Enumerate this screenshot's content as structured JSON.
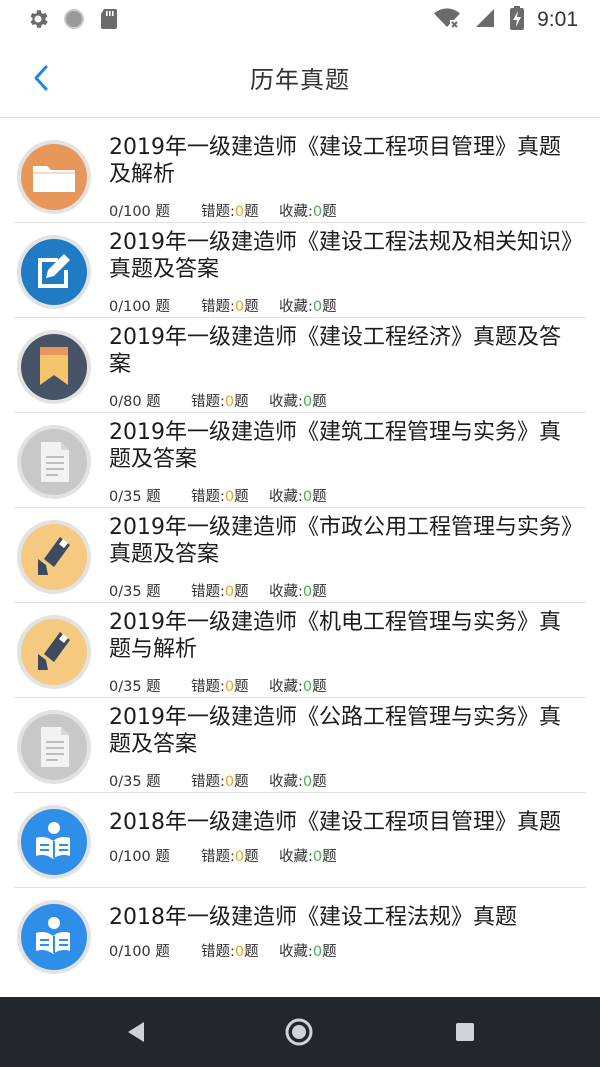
{
  "status_bar": {
    "time": "9:01",
    "left_icons": [
      "gear-icon",
      "circle-icon",
      "sd-card-icon"
    ],
    "right_icons": [
      "wifi-icon",
      "signal-icon",
      "battery-charging-icon"
    ]
  },
  "header": {
    "title": "历年真题",
    "back_icon": "chevron-left-icon"
  },
  "colors": {
    "accent": "#1e88e5",
    "wrong_count": "#f0a020",
    "fav_count": "#4cb050",
    "nav_bar": "#23262d"
  },
  "stat_labels": {
    "wrong": "错题:",
    "fav": "收藏:",
    "unit": "题"
  },
  "items": [
    {
      "title": "2019年一级建造师《建设工程项目管理》真题及解析",
      "total": "0/100 题",
      "wrong": "0",
      "fav": "0",
      "icon": "folder-icon"
    },
    {
      "title": "2019年一级建造师《建设工程法规及相关知识》真题及答案",
      "total": "0/100 题",
      "wrong": "0",
      "fav": "0",
      "icon": "edit-icon"
    },
    {
      "title": "2019年一级建造师《建设工程经济》真题及答案",
      "total": "0/80 题",
      "wrong": "0",
      "fav": "0",
      "icon": "bookmark-icon"
    },
    {
      "title": "2019年一级建造师《建筑工程管理与实务》真题及答案",
      "total": "0/35 题",
      "wrong": "0",
      "fav": "0",
      "icon": "document-icon"
    },
    {
      "title": " 2019年一级建造师《市政公用工程管理与实务》真题及答案",
      "total": "0/35 题",
      "wrong": "0",
      "fav": "0",
      "icon": "pencil-check-icon"
    },
    {
      "title": "2019年一级建造师《机电工程管理与实务》真题与解析",
      "total": "0/35 题",
      "wrong": "0",
      "fav": "0",
      "icon": "pencil-check-icon"
    },
    {
      "title": "2019年一级建造师《公路工程管理与实务》真题及答案",
      "total": "0/35 题",
      "wrong": "0",
      "fav": "0",
      "icon": "document-icon"
    },
    {
      "title": "2018年一级建造师《建设工程项目管理》真题",
      "total": "0/100 题",
      "wrong": "0",
      "fav": "0",
      "icon": "reader-icon"
    },
    {
      "title": "2018年一级建造师《建设工程法规》真题",
      "total": "0/100 题",
      "wrong": "0",
      "fav": "0",
      "icon": "reader-icon"
    }
  ],
  "nav_bar": {
    "buttons": [
      "back-triangle-icon",
      "home-circle-icon",
      "recents-square-icon"
    ]
  }
}
